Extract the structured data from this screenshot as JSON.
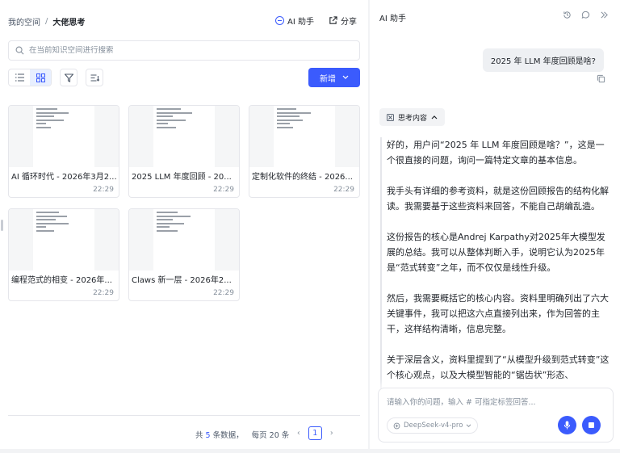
{
  "breadcrumb": {
    "root": "我的空间",
    "separator": "/",
    "current": "大佬思考"
  },
  "top_actions": {
    "ai_label": "AI 助手",
    "share_label": "分享"
  },
  "search": {
    "placeholder": "在当前知识空间进行搜索"
  },
  "toolbar": {
    "new_label": "新增"
  },
  "cards": [
    {
      "title": "AI 循环时代 - 2026年3月2...",
      "time": "22:29"
    },
    {
      "title": "2025 LLM 年度回顾 - 20...",
      "time": "22:29"
    },
    {
      "title": "定制化软件的终结 - 2026...",
      "time": "22:29"
    },
    {
      "title": "编程范式的相变 - 2026年...",
      "time": "22:29"
    },
    {
      "title": "Claws 新一层 - 2026年2...",
      "time": "22:29"
    }
  ],
  "pager": {
    "prefix": "共",
    "total": "5",
    "suffix": "条数据，",
    "per_page": "每页 20 条",
    "page": "1",
    "prev": "‹",
    "next": "›"
  },
  "assistant": {
    "title": "AI 助手",
    "user_message": "2025 年 LLM 年度回顾是啥?",
    "think_label": "思考内容",
    "think_paragraphs": [
      "好的，用户问“2025 年 LLM 年度回顾是啥？”，这是一个很直接的问题，询问一篇特定文章的基本信息。",
      "我手头有详细的参考资料，就是这份回顾报告的结构化解读。我需要基于这些资料来回答，不能自己胡编乱造。",
      "这份报告的核心是Andrej Karpathy对2025年大模型发展的总结。我可以从整体判断入手，说明它认为2025年是“范式转变”之年，而不仅仅是线性升级。",
      "然后，我需要概括它的核心内容。资料里明确列出了六大关键事件，我可以把这六点直接列出来，作为回答的主干，这样结构清晰，信息完整。",
      "关于深层含义，资料里提到了“从模型升级到范式转变”这个核心观点，以及大模型智能的“锯齿状”形态、"
    ],
    "input_placeholder": "请输入你的问题，输入 # 可指定标签回答...",
    "model": "DeepSeek-v4-pro"
  },
  "colors": {
    "accent": "#3b5bfd",
    "border": "#e5e6eb",
    "muted": "#86909c"
  }
}
